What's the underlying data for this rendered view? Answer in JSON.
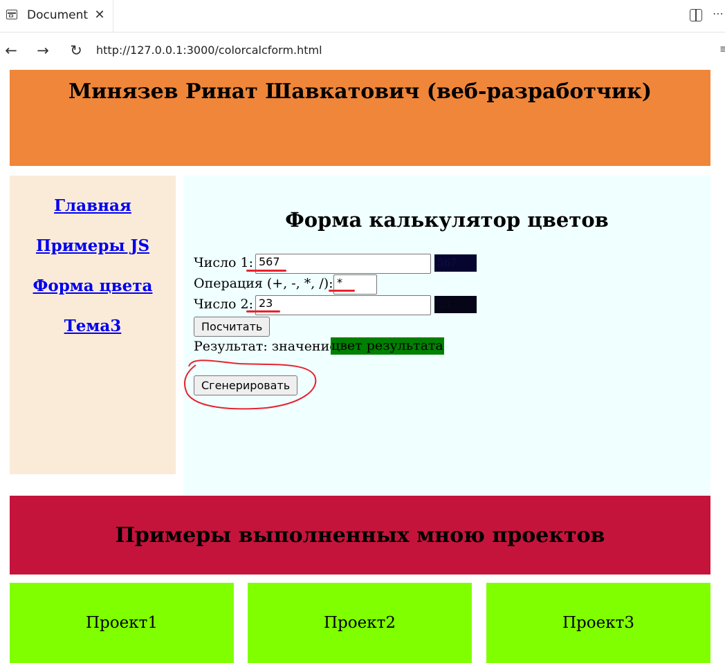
{
  "browser": {
    "tab_title": "Document",
    "url": "http://127.0.0.1:3000/colorcalcform.html"
  },
  "header": {
    "title": "Минязев Ринат Шавкатович (веб-разработчик)"
  },
  "sidebar": {
    "items": [
      {
        "label": "Главная"
      },
      {
        "label": "Примеры JS"
      },
      {
        "label": "Форма цвета"
      },
      {
        "label": "Тема3"
      }
    ]
  },
  "form": {
    "title": "Форма калькулятор цветов",
    "number1_label": "Число 1:",
    "number1_value": "567",
    "number1_swatch_text": "567",
    "operation_label": "Операция (+, -, *, /):",
    "operation_value": "*",
    "number2_label": "Число 2:",
    "number2_value": "23",
    "number2_swatch_text": "23",
    "calc_button": "Посчитать",
    "result_label": "Результат: значение",
    "result_color_text": "цвет результата",
    "generate_button": "Сгенерировать",
    "swatch1_color": "#050530",
    "swatch2_color": "#050517",
    "result_color": "#008000"
  },
  "footer": {
    "title": "Примеры выполненных мною проектов"
  },
  "projects": [
    {
      "label": "Проект1"
    },
    {
      "label": "Проект2"
    },
    {
      "label": "Проект3"
    }
  ],
  "colors": {
    "header_bg": "#ef863a",
    "sidebar_bg": "#faebd8",
    "main_bg": "#f0ffff",
    "footer_bg": "#c5143c",
    "project_bg": "#80ff00",
    "annotation": "#e8222e"
  }
}
